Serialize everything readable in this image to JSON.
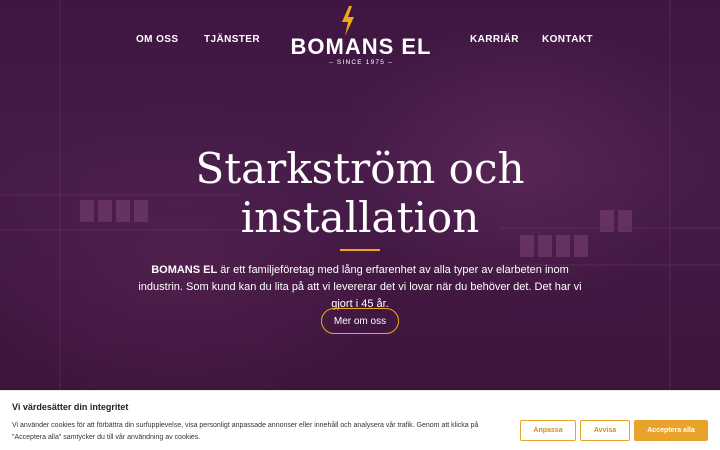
{
  "nav": {
    "items": [
      {
        "label": "OM OSS"
      },
      {
        "label": "TJÄNSTER"
      },
      {
        "label": "KARRIÄR"
      },
      {
        "label": "KONTAKT"
      }
    ]
  },
  "logo": {
    "name": "BOMANS EL",
    "since": "– SINCE 1975 –",
    "accent": "#f0a818"
  },
  "hero": {
    "title_line1": "Starkström och",
    "title_line2": "installation",
    "intro_brand": "BOMANS EL",
    "intro_text": " är ett familjeföretag med lång erfarenhet av alla typer av elarbeten inom industrin. Som kund kan du lita på att vi levererar det vi lovar när du behöver det. Det har vi gjort i 45 år.",
    "cta_label": "Mer om oss"
  },
  "cookie": {
    "title": "Vi värdesätter din integritet",
    "text": "Vi använder cookies för att förbättra din surfupplevelse, visa personligt anpassade annonser eller innehåll och analysera vår trafik. Genom att klicka på \"Acceptera alla\" samtycker du till vår användning av cookies.",
    "customize_label": "Anpassa",
    "reject_label": "Avvisa",
    "accept_label": "Acceptera alla",
    "accent": "#e8a42a"
  }
}
